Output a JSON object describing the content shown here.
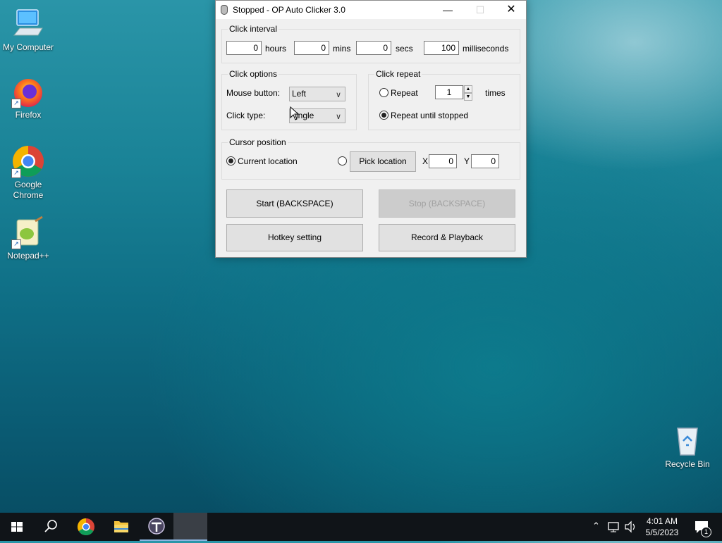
{
  "desktop": {
    "icons": [
      {
        "label": "My Computer",
        "icon": "computer-icon"
      },
      {
        "label": "Firefox",
        "icon": "firefox-icon"
      },
      {
        "label": "Google Chrome",
        "icon": "chrome-icon"
      },
      {
        "label": "Notepad++",
        "icon": "notepadpp-icon"
      },
      {
        "label": "Recycle Bin",
        "icon": "recycle-bin-icon"
      }
    ]
  },
  "window": {
    "title": "Stopped - OP Auto Clicker 3.0",
    "click_interval": {
      "label": "Click interval",
      "hours_value": "0",
      "hours_label": "hours",
      "mins_value": "0",
      "mins_label": "mins",
      "secs_value": "0",
      "secs_label": "secs",
      "ms_value": "100",
      "ms_label": "milliseconds"
    },
    "click_options": {
      "label": "Click options",
      "mouse_button_label": "Mouse button:",
      "mouse_button_value": "Left",
      "click_type_label": "Click type:",
      "click_type_value": "ingle"
    },
    "click_repeat": {
      "label": "Click repeat",
      "repeat_label": "Repeat",
      "repeat_value": "1",
      "times_label": "times",
      "until_stopped_label": "Repeat until stopped",
      "selected": "until_stopped"
    },
    "cursor_position": {
      "label": "Cursor position",
      "current_location_label": "Current location",
      "pick_location_label": "Pick location",
      "x_label": "X",
      "x_value": "0",
      "y_label": "Y",
      "y_value": "0",
      "selected": "current"
    },
    "buttons": {
      "start": "Start (BACKSPACE)",
      "stop": "Stop (BACKSPACE)",
      "hotkey": "Hotkey setting",
      "record": "Record & Playback"
    }
  },
  "taskbar": {
    "time": "4:01 AM",
    "date": "5/5/2023",
    "notification_count": "1"
  }
}
